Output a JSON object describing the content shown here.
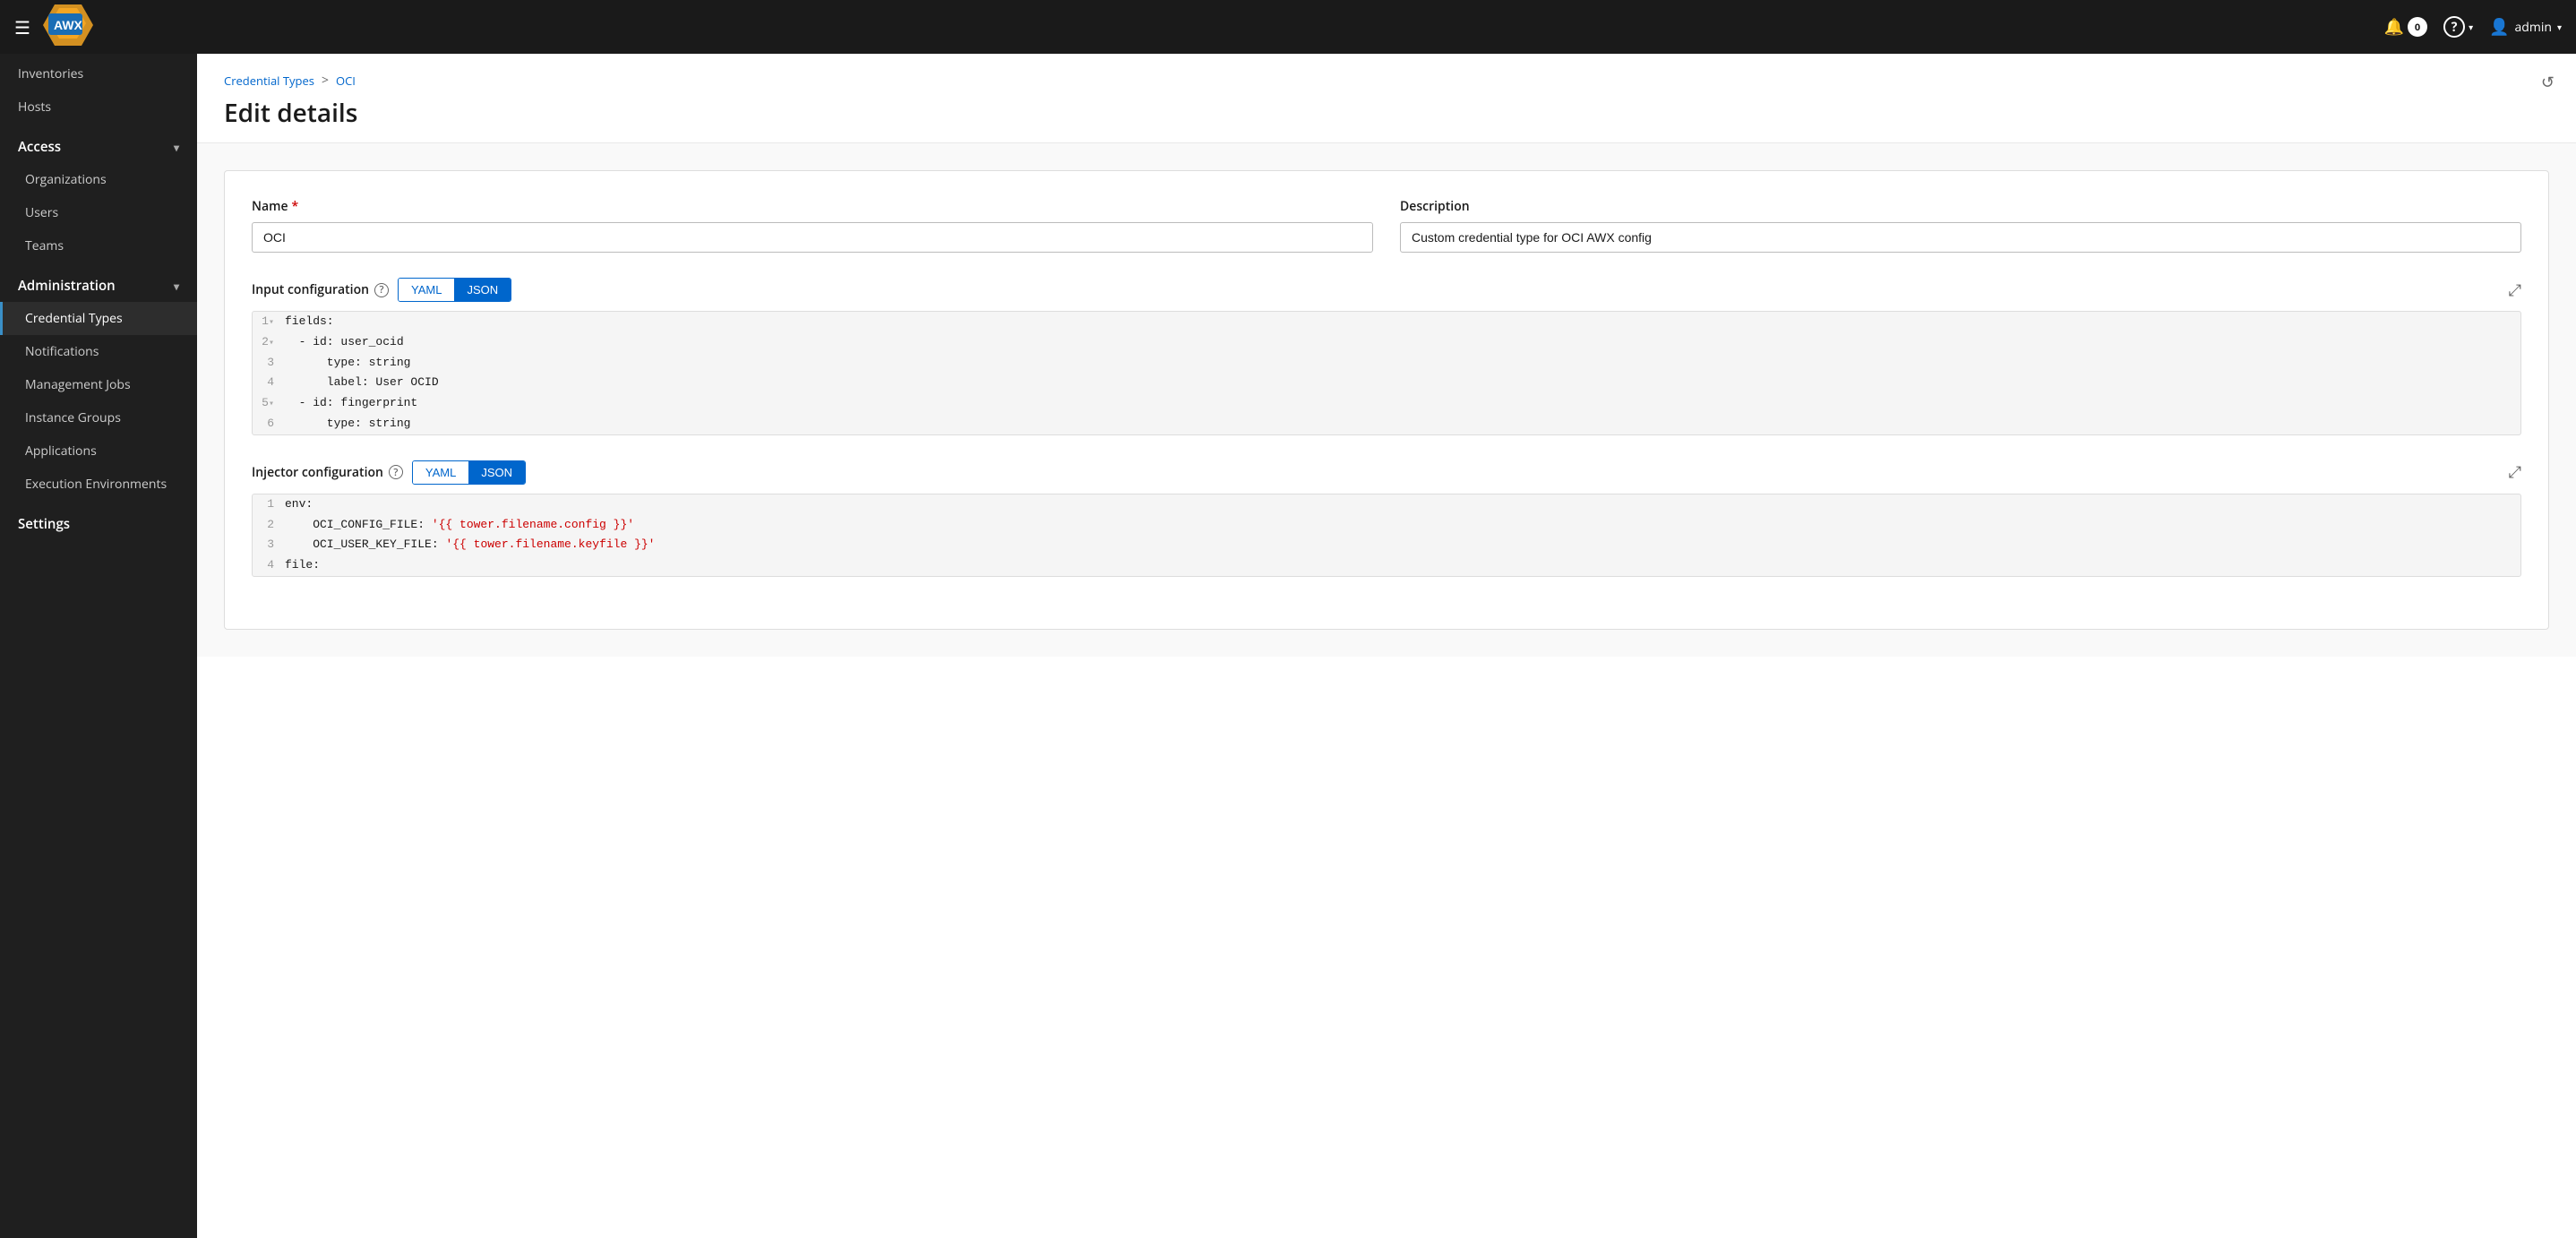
{
  "navbar": {
    "hamburger_label": "☰",
    "logo_text": "AWX",
    "notification_count": "0",
    "help_label": "?",
    "user_label": "admin",
    "dropdown_arrow": "▾"
  },
  "sidebar": {
    "top_items": [
      {
        "label": "Inventories"
      },
      {
        "label": "Hosts"
      }
    ],
    "groups": [
      {
        "label": "Access",
        "items": [
          {
            "label": "Organizations"
          },
          {
            "label": "Users"
          },
          {
            "label": "Teams"
          }
        ]
      },
      {
        "label": "Administration",
        "items": [
          {
            "label": "Credential Types",
            "active": true
          },
          {
            "label": "Notifications"
          },
          {
            "label": "Management Jobs"
          },
          {
            "label": "Instance Groups"
          },
          {
            "label": "Applications"
          },
          {
            "label": "Execution Environments"
          }
        ]
      },
      {
        "label": "Settings",
        "items": []
      }
    ]
  },
  "breadcrumb": {
    "parent_label": "Credential Types",
    "separator": ">",
    "current_label": "OCI"
  },
  "page": {
    "title": "Edit details",
    "history_icon": "↺"
  },
  "form": {
    "name_label": "Name",
    "name_required": "*",
    "name_value": "OCI",
    "description_label": "Description",
    "description_value": "Custom credential type for OCI AWX config",
    "input_config_label": "Input configuration",
    "yaml_label": "YAML",
    "json_label": "JSON",
    "injector_config_label": "Injector configuration",
    "expand_icon": "⤢",
    "help_icon": "?"
  },
  "input_config_code": [
    {
      "num": "1",
      "has_collapse": true,
      "indent": "",
      "content": "fields:"
    },
    {
      "num": "2",
      "has_collapse": true,
      "indent": "  ",
      "content": "- id: user_ocid"
    },
    {
      "num": "3",
      "has_collapse": false,
      "indent": "    ",
      "content": "type: string"
    },
    {
      "num": "4",
      "has_collapse": false,
      "indent": "    ",
      "content": "label: User OCID"
    },
    {
      "num": "5",
      "has_collapse": true,
      "indent": "  ",
      "content": "- id: fingerprint"
    },
    {
      "num": "6",
      "has_collapse": false,
      "indent": "    ",
      "content": "type: string"
    }
  ],
  "injector_config_code": [
    {
      "num": "1",
      "has_collapse": false,
      "content": "env:",
      "type": "plain"
    },
    {
      "num": "2",
      "has_collapse": false,
      "content": "    OCI_CONFIG_FILE: ",
      "string_part": "'{{ tower.filename.config }}'",
      "type": "mixed"
    },
    {
      "num": "3",
      "has_collapse": false,
      "content": "    OCI_USER_KEY_FILE: ",
      "string_part": "'{{ tower.filename.keyfile }}'",
      "type": "mixed"
    },
    {
      "num": "4",
      "has_collapse": false,
      "content": "file:",
      "type": "plain"
    }
  ]
}
